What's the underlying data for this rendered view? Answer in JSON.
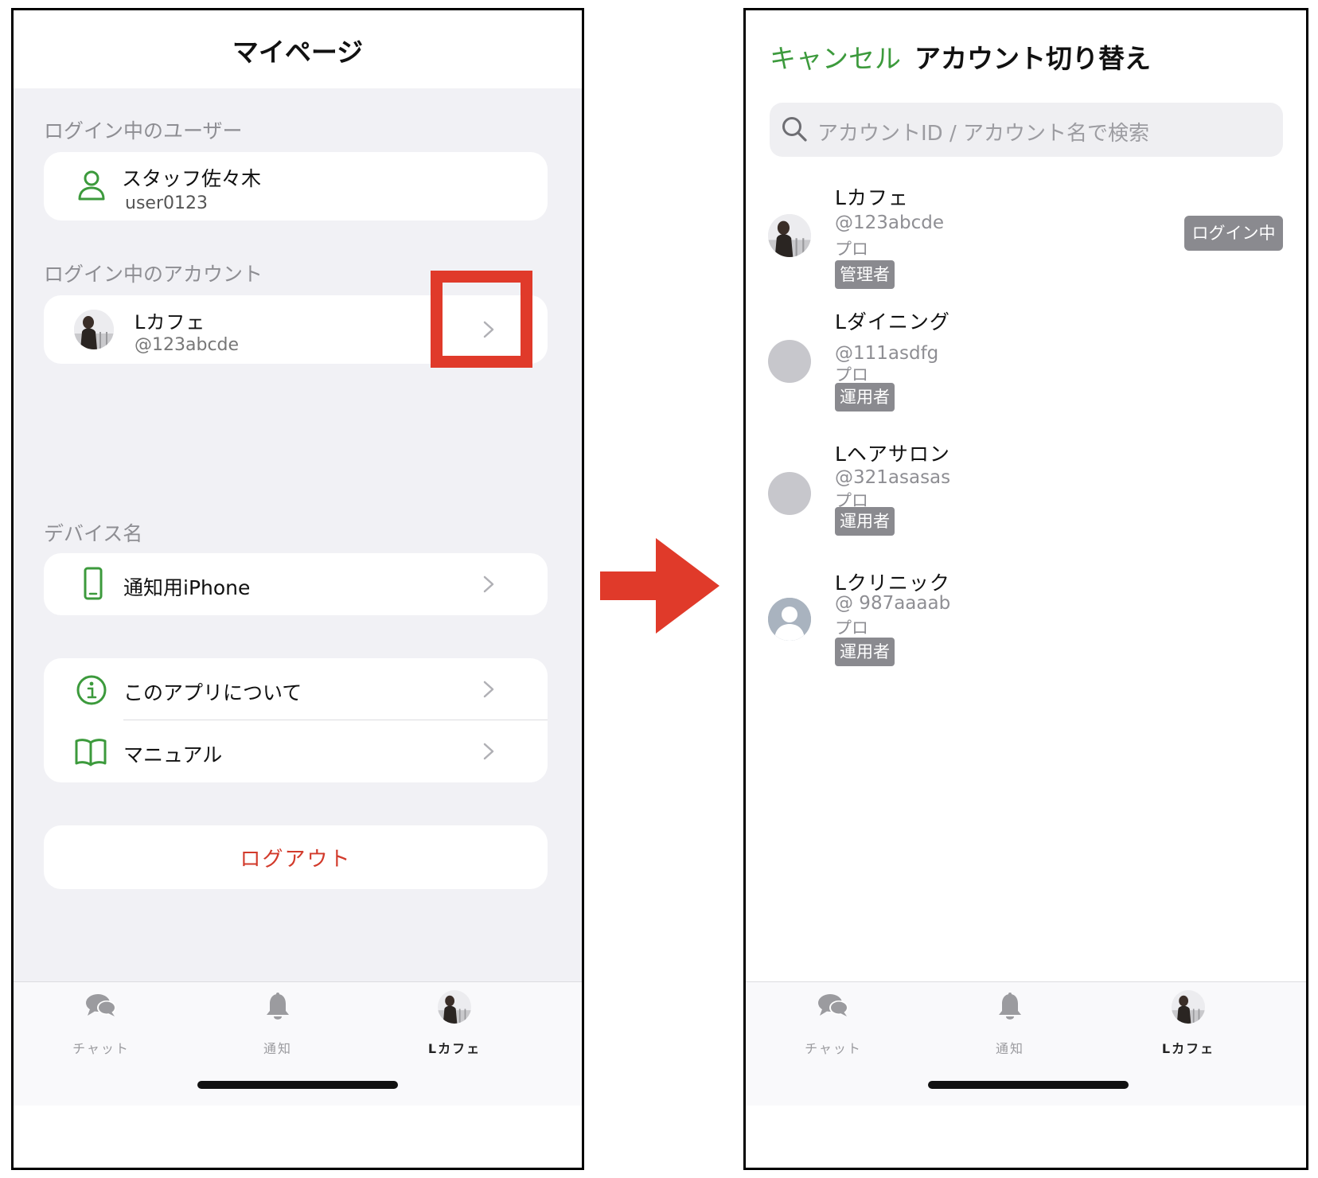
{
  "left": {
    "title": "マイページ",
    "user_section": "ログイン中のユーザー",
    "user_name": "スタッフ佐々木",
    "user_id": "user0123",
    "account_section": "ログイン中のアカウント",
    "account_name": "Lカフェ",
    "account_id": "@123abcde",
    "device_section": "デバイス名",
    "device_name": "通知用iPhone",
    "about_label": "このアプリについて",
    "manual_label": "マニュアル",
    "logout_label": "ログアウト"
  },
  "tabbar": {
    "chat": "チャット",
    "notifications": "通知",
    "account": "Lカフェ"
  },
  "right": {
    "cancel_label": "キャンセル",
    "title": "アカウント切り替え",
    "search_placeholder": "アカウントID / アカウント名で検索",
    "login_badge": "ログイン中",
    "accounts": [
      {
        "name": "Lカフェ",
        "id": "@123abcde",
        "plan": "プロ",
        "role": "管理者"
      },
      {
        "name": "Lダイニング",
        "id": "@111asdfg",
        "plan": "プロ",
        "role": "運用者"
      },
      {
        "name": "Lヘアサロン",
        "id": "@321asasas",
        "plan": "プロ",
        "role": "運用者"
      },
      {
        "name": "Lクリニック",
        "id": "@ 987aaaab",
        "plan": "プロ",
        "role": "運用者"
      }
    ]
  },
  "colors": {
    "accent_green": "#3c9a3c",
    "logout_red": "#d23a2b",
    "highlight_red": "#e03a2a",
    "badge_gray": "#8a8a8f",
    "background_gray": "#f1f1f5"
  }
}
